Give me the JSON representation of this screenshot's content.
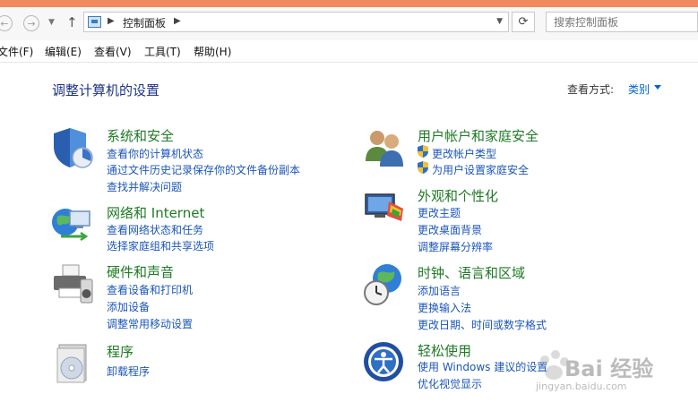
{
  "address_bar": {
    "crumb": "控制面板"
  },
  "search": {
    "placeholder": "搜索控制面板"
  },
  "menu": [
    "文件(F)",
    "编辑(E)",
    "查看(V)",
    "工具(T)",
    "帮助(H)"
  ],
  "page_title": "调整计算机的设置",
  "view_by": {
    "label": "查看方式:",
    "value": "类别"
  },
  "categories": [
    {
      "title": "系统和安全",
      "icon": "shield-icon",
      "links": [
        "查看你的计算机状态",
        "通过文件历史记录保存你的文件备份副本",
        "查找并解决问题"
      ]
    },
    {
      "title": "网络和 Internet",
      "icon": "network-globe-icon",
      "links": [
        "查看网络状态和任务",
        "选择家庭组和共享选项"
      ]
    },
    {
      "title": "硬件和声音",
      "icon": "printer-speaker-icon",
      "links": [
        "查看设备和打印机",
        "添加设备",
        "调整常用移动设置"
      ]
    },
    {
      "title": "程序",
      "icon": "programs-disc-icon",
      "links": [
        "卸载程序"
      ]
    },
    {
      "title": "用户帐户和家庭安全",
      "icon": "users-icon",
      "links": [
        "更改帐户类型",
        "为用户设置家庭安全"
      ]
    },
    {
      "title": "外观和个性化",
      "icon": "monitor-palette-icon",
      "links": [
        "更改主题",
        "更改桌面背景",
        "调整屏幕分辨率"
      ]
    },
    {
      "title": "时钟、语言和区域",
      "icon": "clock-globe-icon",
      "links": [
        "添加语言",
        "更换输入法",
        "更改日期、时间或数字格式"
      ]
    },
    {
      "title": "轻松使用",
      "icon": "ease-of-access-icon",
      "links": [
        "使用 Windows 建议的设置",
        "优化视觉显示"
      ]
    }
  ],
  "watermark": {
    "text": "Bai 经验",
    "url": "jingyan.baidu.com"
  },
  "colors": {
    "title_bar": "#f08a5d",
    "category_title": "#1e7a24",
    "link": "#1b56b8",
    "page_title": "#1e3287"
  }
}
